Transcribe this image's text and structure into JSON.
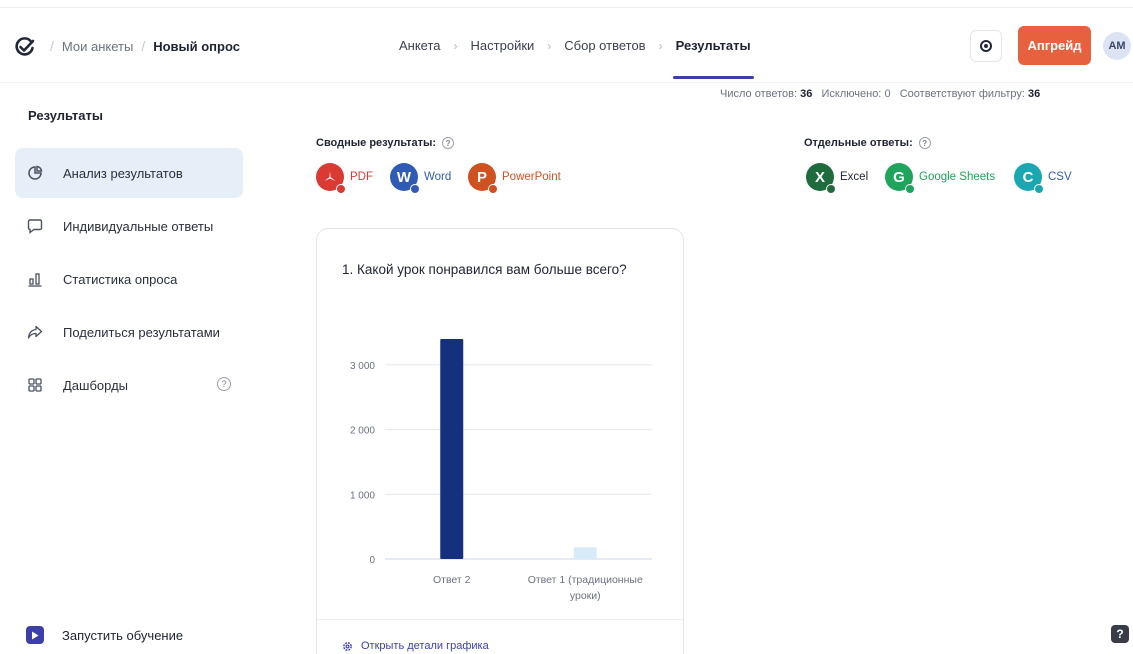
{
  "breadcrumb": {
    "root": "Мои анкеты",
    "current": "Новый опрос"
  },
  "steps": [
    "Анкета",
    "Настройки",
    "Сбор ответов",
    "Результаты"
  ],
  "active_step": "Результаты",
  "header": {
    "upgrade_label": "Апгрейд",
    "avatar_initials": "AM"
  },
  "sidebar": {
    "title": "Результаты",
    "items": [
      {
        "label": "Анализ результатов",
        "icon": "pie-chart-icon",
        "active": true
      },
      {
        "label": "Индивидуальные ответы",
        "icon": "chat-bubble-icon"
      },
      {
        "label": "Статистика опроса",
        "icon": "bar-stats-icon"
      },
      {
        "label": "Поделиться результатами",
        "icon": "share-arrow-icon"
      },
      {
        "label": "Дашборды",
        "icon": "grid-icon",
        "help": "?"
      }
    ],
    "tour_label": "Запустить обучение"
  },
  "stats": {
    "responses_label": "Число ответов:",
    "responses": "36",
    "excluded_label": "Исключено:",
    "excluded": "0",
    "filter_label": "Соответствуют фильтру:",
    "filter": "36"
  },
  "summary_export": {
    "label": "Сводные результаты:",
    "formats": [
      {
        "name": "PDF",
        "letter": "",
        "color": "#d93a34",
        "text_color": "#d93a34"
      },
      {
        "name": "Word",
        "letter": "W",
        "color": "#2f5bb7",
        "text_color": "#2f5bb7"
      },
      {
        "name": "PowerPoint",
        "letter": "P",
        "color": "#d1501f",
        "text_color": "#d1501f"
      }
    ]
  },
  "individual_export": {
    "label": "Отдельные ответы:",
    "formats": [
      {
        "name": "Excel",
        "letter": "X",
        "color": "#1e6b3d",
        "text_color": "#1f2333"
      },
      {
        "name": "Google Sheets",
        "letter": "G",
        "color": "#1ea45b",
        "text_color": "#1ea45b"
      },
      {
        "name": "CSV",
        "letter": "C",
        "color": "#1aa7b2",
        "text_color": "#2f5bb7"
      }
    ]
  },
  "question_card": {
    "question": "1. Какой урок понравился вам больше всего?",
    "footer_link": "Открыть детали графика"
  },
  "chart_data": {
    "type": "bar",
    "categories": [
      "Ответ 2",
      "Ответ 1 (традиционные уроки)"
    ],
    "category_lines": [
      [
        "Ответ 2"
      ],
      [
        "Ответ 1 (традиционные",
        "уроки)"
      ]
    ],
    "values": [
      3400,
      180
    ],
    "ylim": [
      0,
      3400
    ],
    "yticks": [
      0,
      1000,
      2000,
      3000
    ],
    "ytick_labels": [
      "0",
      "1 000",
      "2 000",
      "3 000"
    ],
    "colors": [
      "#14307f",
      "#d7ecf8"
    ],
    "grid": true
  }
}
